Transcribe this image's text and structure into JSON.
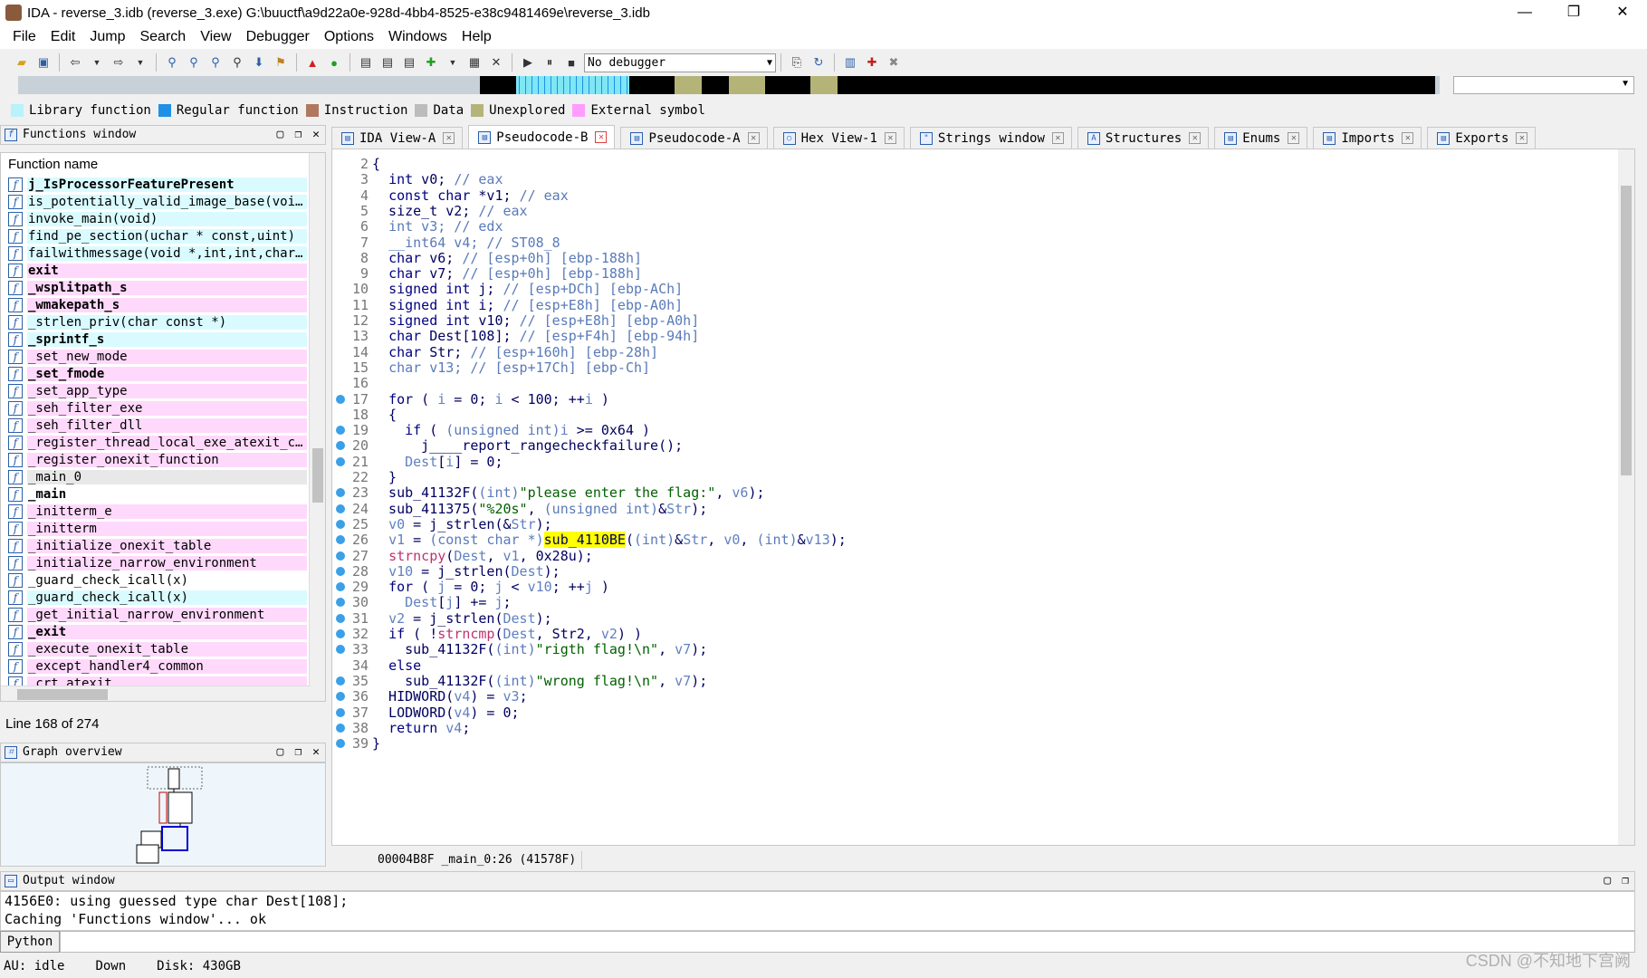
{
  "window": {
    "title": "IDA - reverse_3.idb (reverse_3.exe) G:\\buuctf\\a9d22a0e-928d-4bb4-8525-e38c9481469e\\reverse_3.idb",
    "minimize": "—",
    "maximize": "❐",
    "close": "✕"
  },
  "menu": [
    "File",
    "Edit",
    "Jump",
    "Search",
    "View",
    "Debugger",
    "Options",
    "Windows",
    "Help"
  ],
  "toolbar": {
    "debugger_select": "No debugger"
  },
  "legend": [
    {
      "label": "Library function",
      "color": "#b8f2fa"
    },
    {
      "label": "Regular function",
      "color": "#1e90e8"
    },
    {
      "label": "Instruction",
      "color": "#b07860"
    },
    {
      "label": "Data",
      "color": "#bcbcbc"
    },
    {
      "label": "Unexplored",
      "color": "#b4b478"
    },
    {
      "label": "External symbol",
      "color": "#ff9cff"
    }
  ],
  "functions_window": {
    "title": "Functions window",
    "column": "Function name",
    "items": [
      {
        "name": "j_IsProcessorFeaturePresent",
        "kind": "lib",
        "bold": true
      },
      {
        "name": "is_potentially_valid_image_base(voi…",
        "kind": "lib",
        "bold": false
      },
      {
        "name": "invoke_main(void)",
        "kind": "lib",
        "bold": false
      },
      {
        "name": "find_pe_section(uchar * const,uint)",
        "kind": "lib",
        "bold": false
      },
      {
        "name": "failwithmessage(void *,int,int,char…",
        "kind": "lib",
        "bold": false
      },
      {
        "name": "exit",
        "kind": "ext",
        "bold": true
      },
      {
        "name": "_wsplitpath_s",
        "kind": "ext",
        "bold": true
      },
      {
        "name": "_wmakepath_s",
        "kind": "ext",
        "bold": true
      },
      {
        "name": "_strlen_priv(char const *)",
        "kind": "lib",
        "bold": false
      },
      {
        "name": "_sprintf_s",
        "kind": "lib",
        "bold": true
      },
      {
        "name": "_set_new_mode",
        "kind": "ext",
        "bold": false
      },
      {
        "name": "_set_fmode",
        "kind": "ext",
        "bold": true
      },
      {
        "name": "_set_app_type",
        "kind": "ext",
        "bold": false
      },
      {
        "name": "_seh_filter_exe",
        "kind": "ext",
        "bold": false
      },
      {
        "name": "_seh_filter_dll",
        "kind": "ext",
        "bold": false
      },
      {
        "name": "_register_thread_local_exe_atexit_c…",
        "kind": "ext",
        "bold": false
      },
      {
        "name": "_register_onexit_function",
        "kind": "ext",
        "bold": false
      },
      {
        "name": "_main_0",
        "kind": "sel",
        "bold": false
      },
      {
        "name": "_main",
        "kind": "reg",
        "bold": true
      },
      {
        "name": "_initterm_e",
        "kind": "ext",
        "bold": false
      },
      {
        "name": "_initterm",
        "kind": "ext",
        "bold": false
      },
      {
        "name": "_initialize_onexit_table",
        "kind": "ext",
        "bold": false
      },
      {
        "name": "_initialize_narrow_environment",
        "kind": "ext",
        "bold": false
      },
      {
        "name": "_guard_check_icall(x)",
        "kind": "reg",
        "bold": false
      },
      {
        "name": "_guard_check_icall(x)",
        "kind": "lib",
        "bold": false
      },
      {
        "name": "_get_initial_narrow_environment",
        "kind": "ext",
        "bold": false
      },
      {
        "name": "_exit",
        "kind": "ext",
        "bold": true
      },
      {
        "name": "_execute_onexit_table",
        "kind": "ext",
        "bold": false
      },
      {
        "name": "_except_handler4_common",
        "kind": "ext",
        "bold": false
      },
      {
        "name": "_crt_atexit",
        "kind": "ext",
        "bold": false
      }
    ],
    "status": "Line 168 of 274"
  },
  "graph_overview": {
    "title": "Graph overview"
  },
  "tabs": [
    {
      "label": "IDA View-A",
      "active": false
    },
    {
      "label": "Pseudocode-B",
      "active": true
    },
    {
      "label": "Pseudocode-A",
      "active": false
    },
    {
      "label": "Hex View-1",
      "active": false
    },
    {
      "label": "Strings window",
      "active": false
    },
    {
      "label": "Structures",
      "active": false
    },
    {
      "label": "Enums",
      "active": false
    },
    {
      "label": "Imports",
      "active": false
    },
    {
      "label": "Exports",
      "active": false
    }
  ],
  "code": {
    "lines": [
      {
        "n": "2",
        "dot": false,
        "html": "{"
      },
      {
        "n": "3",
        "dot": false,
        "html": "  <span class='kw'>int</span> v0; <span class='cm'>// eax</span>"
      },
      {
        "n": "4",
        "dot": false,
        "html": "  <span class='kw'>const char</span> *v1; <span class='cm'>// eax</span>"
      },
      {
        "n": "5",
        "dot": false,
        "html": "  size_t v2; <span class='cm'>// eax</span>"
      },
      {
        "n": "6",
        "dot": false,
        "html": "  <span class='cm'>int v3; // edx</span>"
      },
      {
        "n": "7",
        "dot": false,
        "html": "  <span class='cm'>__int64 v4; // ST08_8</span>"
      },
      {
        "n": "8",
        "dot": false,
        "html": "  <span class='kw'>char</span> v6; <span class='cm'>// [esp+0h] [ebp-188h]</span>"
      },
      {
        "n": "9",
        "dot": false,
        "html": "  <span class='kw'>char</span> v7; <span class='cm'>// [esp+0h] [ebp-188h]</span>"
      },
      {
        "n": "10",
        "dot": false,
        "html": "  <span class='kw'>signed int</span> j; <span class='cm'>// [esp+DCh] [ebp-ACh]</span>"
      },
      {
        "n": "11",
        "dot": false,
        "html": "  <span class='kw'>signed int</span> i; <span class='cm'>// [esp+E8h] [ebp-A0h]</span>"
      },
      {
        "n": "12",
        "dot": false,
        "html": "  <span class='kw'>signed int</span> v10; <span class='cm'>// [esp+E8h] [ebp-A0h]</span>"
      },
      {
        "n": "13",
        "dot": false,
        "html": "  <span class='kw'>char</span> Dest[108]; <span class='cm'>// [esp+F4h] [ebp-94h]</span>"
      },
      {
        "n": "14",
        "dot": false,
        "html": "  <span class='kw'>char</span> Str; <span class='cm'>// [esp+160h] [ebp-28h]</span>"
      },
      {
        "n": "15",
        "dot": false,
        "html": "  <span class='cm'>char v13; // [esp+17Ch] [ebp-Ch]</span>"
      },
      {
        "n": "16",
        "dot": false,
        "html": ""
      },
      {
        "n": "17",
        "dot": true,
        "html": "  <span class='kw'>for</span> ( <span class='var'>i</span> = 0; <span class='var'>i</span> &lt; 100; ++<span class='var'>i</span> )"
      },
      {
        "n": "18",
        "dot": false,
        "html": "  {"
      },
      {
        "n": "19",
        "dot": true,
        "html": "    <span class='kw'>if</span> ( <span class='cm'>(unsigned int)</span><span class='var'>i</span> &gt;= 0x64 )"
      },
      {
        "n": "20",
        "dot": true,
        "html": "      j____report_rangecheckfailure();"
      },
      {
        "n": "21",
        "dot": true,
        "html": "    <span class='var'>Dest</span>[<span class='var'>i</span>] = 0;"
      },
      {
        "n": "22",
        "dot": false,
        "html": "  }"
      },
      {
        "n": "23",
        "dot": true,
        "html": "  sub_41132F(<span class='cm'>(int)</span><span class='str'>\"please enter the flag:\"</span>, <span class='var'>v6</span>);"
      },
      {
        "n": "24",
        "dot": true,
        "html": "  sub_411375(<span class='str'>\"%20s\"</span>, <span class='cm'>(unsigned int)</span>&amp;<span class='var'>Str</span>);"
      },
      {
        "n": "25",
        "dot": true,
        "html": "  <span class='var'>v0</span> = j_strlen(&amp;<span class='var'>Str</span>);"
      },
      {
        "n": "26",
        "dot": true,
        "html": "  <span class='var'>v1</span> = <span class='cm'>(const char *)</span><span class='hl'>sub_4110BE</span>(<span class='cm'>(int)</span>&amp;<span class='var'>Str</span>, <span class='var'>v0</span>, <span class='cm'>(int)</span>&amp;<span class='var'>v13</span>);"
      },
      {
        "n": "27",
        "dot": true,
        "html": "  <span style='color:#c03070'>strncpy</span>(<span class='var'>Dest</span>, <span class='var'>v1</span>, 0x28u);"
      },
      {
        "n": "28",
        "dot": true,
        "html": "  <span class='var'>v10</span> = j_strlen(<span class='var'>Dest</span>);"
      },
      {
        "n": "29",
        "dot": true,
        "html": "  <span class='kw'>for</span> ( <span class='var'>j</span> = 0; <span class='var'>j</span> &lt; <span class='var'>v10</span>; ++<span class='var'>j</span> )"
      },
      {
        "n": "30",
        "dot": true,
        "html": "    <span class='var'>Dest</span>[<span class='var'>j</span>] += <span class='var'>j</span>;"
      },
      {
        "n": "31",
        "dot": true,
        "html": "  <span class='var'>v2</span> = j_strlen(<span class='var'>Dest</span>);"
      },
      {
        "n": "32",
        "dot": true,
        "html": "  <span class='kw'>if</span> ( !<span style='color:#c03070'>strncmp</span>(<span class='var'>Dest</span>, Str2, <span class='var'>v2</span>) )"
      },
      {
        "n": "33",
        "dot": true,
        "html": "    sub_41132F(<span class='cm'>(int)</span><span class='str'>\"rigth flag!\\n\"</span>, <span class='var'>v7</span>);"
      },
      {
        "n": "34",
        "dot": false,
        "html": "  <span class='kw'>else</span>"
      },
      {
        "n": "35",
        "dot": true,
        "html": "    sub_41132F(<span class='cm'>(int)</span><span class='str'>\"wrong flag!\\n\"</span>, <span class='var'>v7</span>);"
      },
      {
        "n": "36",
        "dot": true,
        "html": "  HIDWORD(<span class='var'>v4</span>) = <span class='var'>v3</span>;"
      },
      {
        "n": "37",
        "dot": true,
        "html": "  LODWORD(<span class='var'>v4</span>) = 0;"
      },
      {
        "n": "38",
        "dot": true,
        "html": "  <span class='kw'>return</span> <span class='var'>v4</span>;"
      },
      {
        "n": "39",
        "dot": true,
        "html": "}"
      }
    ],
    "status": "00004B8F _main_0:26 (41578F)"
  },
  "output": {
    "title": "Output window",
    "lines": [
      "4156E0: using guessed type char Dest[108];",
      "Caching 'Functions window'... ok"
    ],
    "python_label": "Python"
  },
  "statusbar": {
    "au": "AU:  idle",
    "dir": "Down",
    "disk": "Disk: 430GB"
  },
  "watermark": "CSDN @不知地下宫阙"
}
